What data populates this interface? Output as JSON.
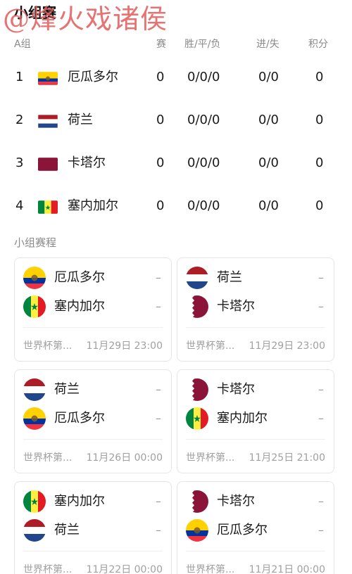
{
  "header": {
    "title": "小组赛",
    "watermark": "@烽火戏诸侯"
  },
  "table": {
    "group_label": "A组",
    "columns": {
      "played": "赛",
      "wdl": "胜/平/负",
      "gd": "进/失",
      "pts": "积分"
    },
    "rows": [
      {
        "rank": "1",
        "team": "厄瓜多尔",
        "flag": "ecuador",
        "played": "0",
        "wdl": "0/0/0",
        "gd": "0/0",
        "pts": "0"
      },
      {
        "rank": "2",
        "team": "荷兰",
        "flag": "netherlands",
        "played": "0",
        "wdl": "0/0/0",
        "gd": "0/0",
        "pts": "0"
      },
      {
        "rank": "3",
        "team": "卡塔尔",
        "flag": "qatar",
        "played": "0",
        "wdl": "0/0/0",
        "gd": "0/0",
        "pts": "0"
      },
      {
        "rank": "4",
        "team": "塞内加尔",
        "flag": "senegal",
        "played": "0",
        "wdl": "0/0/0",
        "gd": "0/0",
        "pts": "0"
      }
    ]
  },
  "schedule": {
    "title": "小组赛程",
    "matches": [
      {
        "home": "厄瓜多尔",
        "home_flag": "ecuador",
        "home_score": "–",
        "away": "塞内加尔",
        "away_flag": "senegal",
        "away_score": "–",
        "competition": "世界杯第...",
        "time": "11月29日 23:00"
      },
      {
        "home": "荷兰",
        "home_flag": "netherlands",
        "home_score": "–",
        "away": "卡塔尔",
        "away_flag": "qatar",
        "away_score": "–",
        "competition": "世界杯第...",
        "time": "11月29日 23:00"
      },
      {
        "home": "荷兰",
        "home_flag": "netherlands",
        "home_score": "–",
        "away": "厄瓜多尔",
        "away_flag": "ecuador",
        "away_score": "–",
        "competition": "世界杯第...",
        "time": "11月26日 00:00"
      },
      {
        "home": "卡塔尔",
        "home_flag": "qatar",
        "home_score": "–",
        "away": "塞内加尔",
        "away_flag": "senegal",
        "away_score": "–",
        "competition": "世界杯第...",
        "time": "11月25日 21:00"
      },
      {
        "home": "塞内加尔",
        "home_flag": "senegal",
        "home_score": "–",
        "away": "荷兰",
        "away_flag": "netherlands",
        "away_score": "–",
        "competition": "世界杯第...",
        "time": "11月22日 00:00"
      },
      {
        "home": "卡塔尔",
        "home_flag": "qatar",
        "home_score": "–",
        "away": "厄瓜多尔",
        "away_flag": "ecuador",
        "away_score": "–",
        "competition": "世界杯第...",
        "time": "11月21日 00:00"
      }
    ]
  },
  "flag_colors": {
    "ecuador": [
      "#FFD100",
      "#0033A0",
      "#EF3340"
    ],
    "netherlands": [
      "#AE1C28",
      "#FFFFFF",
      "#21468B"
    ],
    "qatar": [
      "#FFFFFF",
      "#8A1538"
    ],
    "senegal": [
      "#00853F",
      "#FDEF42",
      "#E31B23"
    ]
  }
}
